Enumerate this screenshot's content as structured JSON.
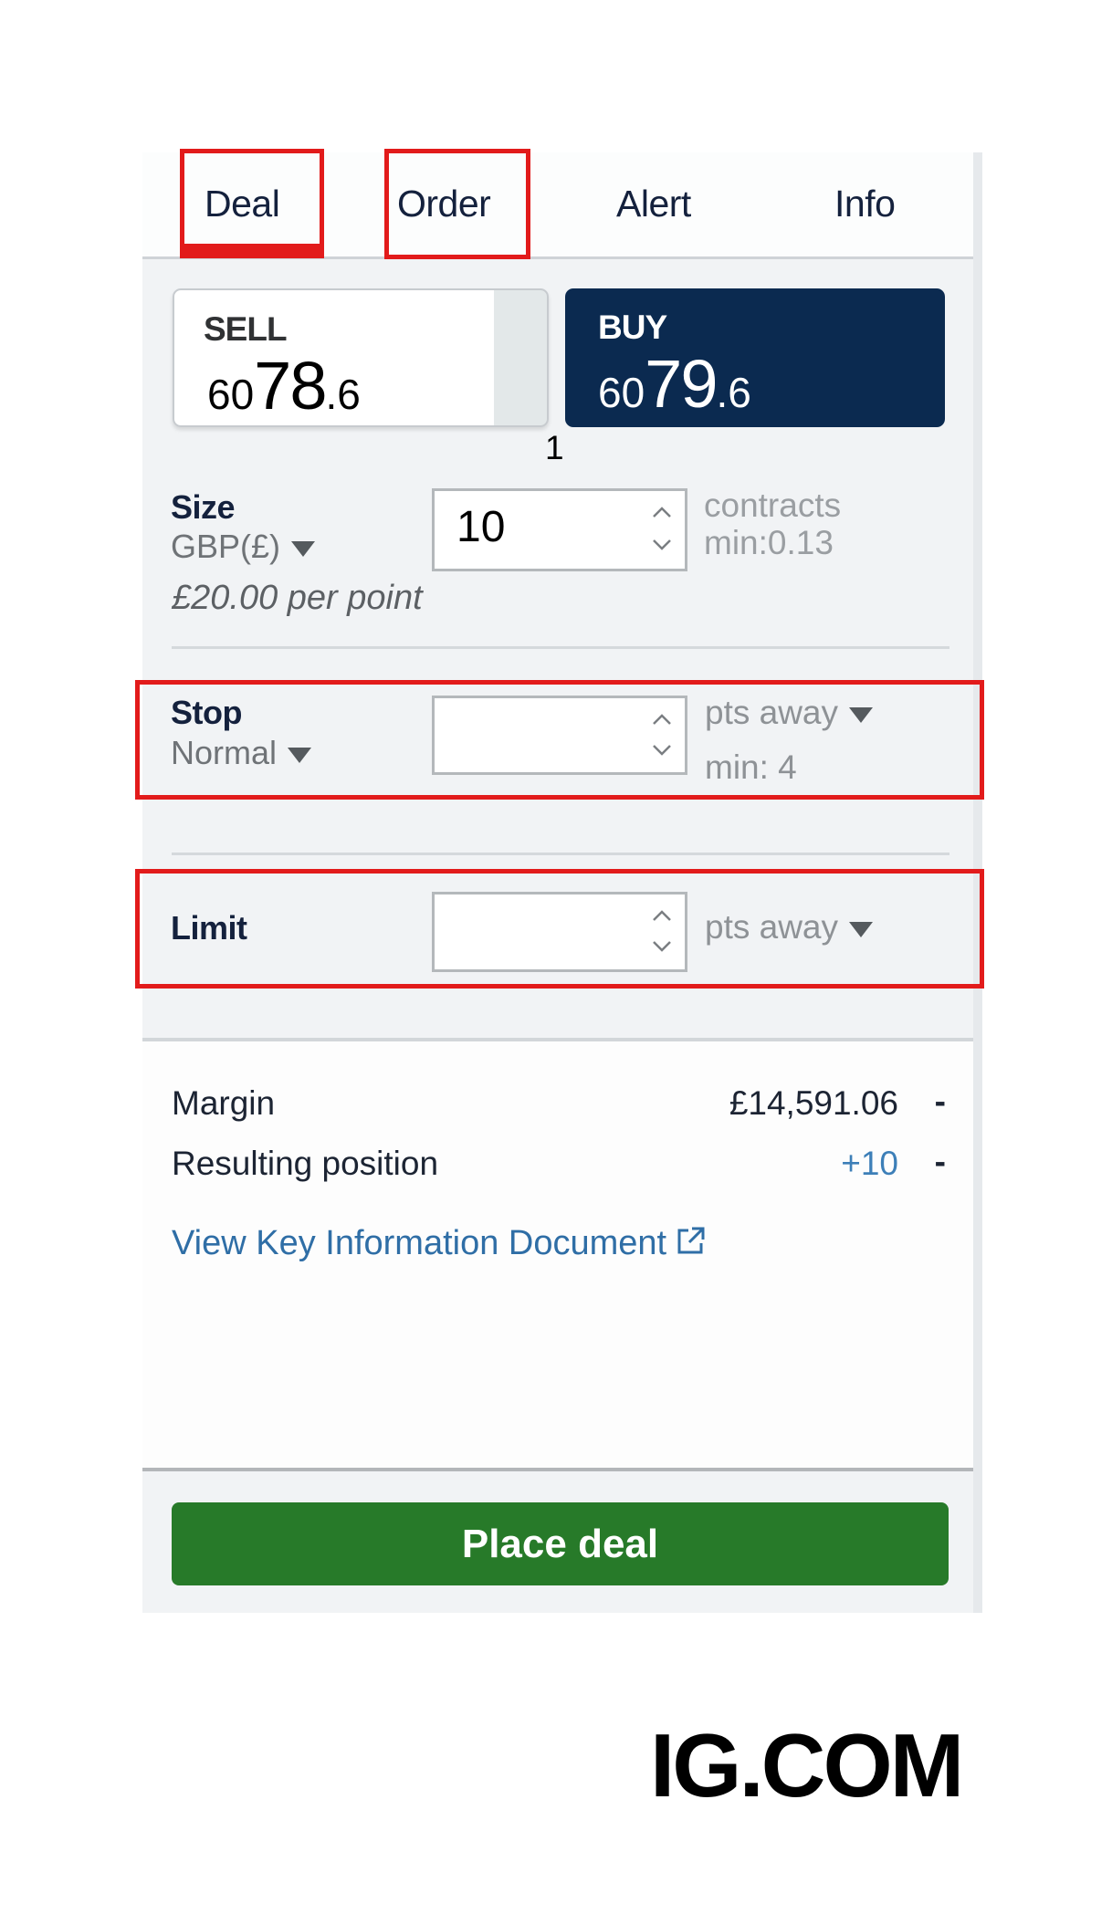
{
  "tabs": [
    {
      "label": "Deal",
      "active": true,
      "highlighted": true
    },
    {
      "label": "Order",
      "active": false,
      "highlighted": true
    },
    {
      "label": "Alert",
      "active": false,
      "highlighted": false
    },
    {
      "label": "Info",
      "active": false,
      "highlighted": false
    }
  ],
  "sell": {
    "label": "SELL",
    "price_prefix": "60",
    "price_main": "78",
    "price_suffix": ".6"
  },
  "buy": {
    "label": "BUY",
    "price_prefix": "60",
    "price_main": "79",
    "price_suffix": ".6"
  },
  "spread": "1",
  "size": {
    "label": "Size",
    "currency": "GBP(£)",
    "value": "10",
    "unit": "contracts",
    "min": "min:0.13",
    "per_point": "£20.00 per point"
  },
  "stop": {
    "label": "Stop",
    "type": "Normal",
    "value": "",
    "unit": "pts away",
    "min": "min: 4"
  },
  "limit": {
    "label": "Limit",
    "value": "",
    "unit": "pts away"
  },
  "summary": {
    "margin_label": "Margin",
    "margin_value": "£14,591.06",
    "margin_dash": "-",
    "position_label": "Resulting position",
    "position_value": "+10",
    "position_dash": "-",
    "kid_link": "View Key Information Document"
  },
  "place_deal": "Place deal",
  "brand": "IG.COM",
  "colors": {
    "buy_bg": "#0b2a50",
    "place_deal_bg": "#277a29",
    "highlight": "#e21b1b",
    "link": "#2f6ea6",
    "position_value": "#3d7fb8"
  }
}
